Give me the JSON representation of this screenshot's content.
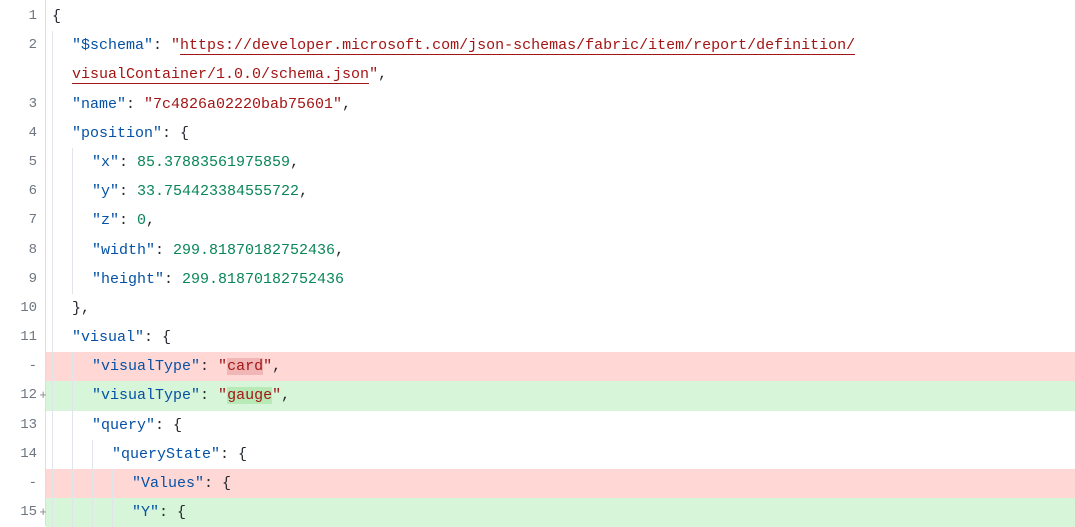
{
  "gutter": {
    "l1": "1",
    "l2": "2",
    "l3": "3",
    "l4": "4",
    "l5": "5",
    "l6": "6",
    "l7": "7",
    "l8": "8",
    "l9": "9",
    "l10": "10",
    "l11": "11",
    "ldel1": "-",
    "l12": "12",
    "s12": "+",
    "l13": "13",
    "l14": "14",
    "ldel2": "-",
    "l15": "15",
    "s15": "+"
  },
  "code": {
    "l1_open": "{",
    "l2_key": "\"$schema\"",
    "l2_colon": ": ",
    "l2_q1": "\"",
    "l2_url": "https://developer.microsoft.com/json-schemas/fabric/item/report/definition/",
    "l2b_url": "visualContainer/1.0.0/schema.json",
    "l2b_q2": "\"",
    "l2b_comma": ",",
    "l3_key": "\"name\"",
    "l3_colon": ": ",
    "l3_val": "\"7c4826a02220bab75601\"",
    "l3_comma": ",",
    "l4_key": "\"position\"",
    "l4_colon": ": ",
    "l4_open": "{",
    "l5_key": "\"x\"",
    "l5_colon": ": ",
    "l5_val": "85.37883561975859",
    "l5_comma": ",",
    "l6_key": "\"y\"",
    "l6_colon": ": ",
    "l6_val": "33.754423384555722",
    "l6_comma": ",",
    "l7_key": "\"z\"",
    "l7_colon": ": ",
    "l7_val": "0",
    "l7_comma": ",",
    "l8_key": "\"width\"",
    "l8_colon": ": ",
    "l8_val": "299.81870182752436",
    "l8_comma": ",",
    "l9_key": "\"height\"",
    "l9_colon": ": ",
    "l9_val": "299.81870182752436",
    "l10_close": "}",
    "l10_comma": ",",
    "l11_key": "\"visual\"",
    "l11_colon": ": ",
    "l11_open": "{",
    "ldel1_key": "\"visualType\"",
    "ldel1_colon": ": ",
    "ldel1_q1": "\"",
    "ldel1_val": "card",
    "ldel1_q2": "\"",
    "ldel1_comma": ",",
    "l12_key": "\"visualType\"",
    "l12_colon": ": ",
    "l12_q1": "\"",
    "l12_val": "gauge",
    "l12_q2": "\"",
    "l12_comma": ",",
    "l13_key": "\"query\"",
    "l13_colon": ": ",
    "l13_open": "{",
    "l14_key": "\"queryState\"",
    "l14_colon": ": ",
    "l14_open": "{",
    "ldel2_key": "\"Values\"",
    "ldel2_colon": ": ",
    "ldel2_open": "{",
    "l15_key": "\"Y\"",
    "l15_colon": ": ",
    "l15_open": "{"
  }
}
